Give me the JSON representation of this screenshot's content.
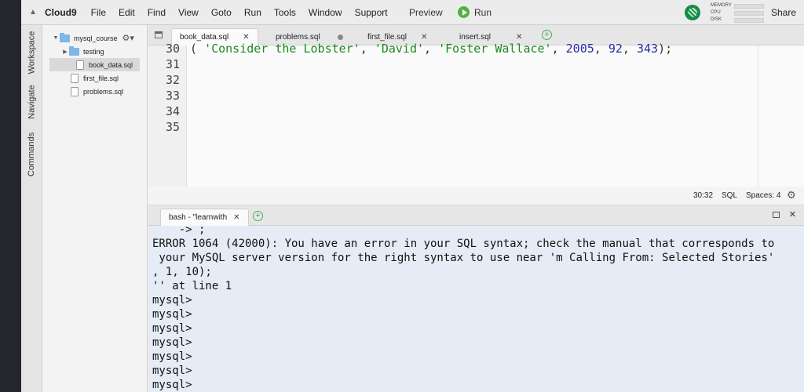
{
  "menubar": {
    "brand": "Cloud9",
    "items": [
      "File",
      "Edit",
      "Find",
      "View",
      "Goto",
      "Run",
      "Tools",
      "Window",
      "Support"
    ],
    "preview": "Preview",
    "run": "Run",
    "meters": [
      "MEMORY",
      "CPU",
      "DISK"
    ],
    "share": "Share"
  },
  "sidetabs": [
    "Workspace",
    "Navigate",
    "Commands"
  ],
  "tree": {
    "root": "mysql_course",
    "items": [
      {
        "label": "testing",
        "type": "folder"
      },
      {
        "label": "book_data.sql",
        "type": "file",
        "selected": true
      },
      {
        "label": "first_file.sql",
        "type": "file"
      },
      {
        "label": "problems.sql",
        "type": "file"
      }
    ]
  },
  "editor_tabs": [
    {
      "label": "book_data.sql",
      "state": "close",
      "active": true
    },
    {
      "label": "problems.sql",
      "state": "unsaved"
    },
    {
      "label": "first_file.sql",
      "state": "close"
    },
    {
      "label": "insert.sql",
      "state": "close"
    }
  ],
  "editor": {
    "line_numbers": [
      "30",
      "31",
      "32",
      "33",
      "34",
      "35"
    ],
    "line30": {
      "open": "(",
      "s1": "'Consider the Lobster'",
      "s2": "'David'",
      "s3": "'Foster Wallace'",
      "n1": "2005",
      "n2": "92",
      "n3": "343",
      "close": ");"
    }
  },
  "status": {
    "position": "30:32",
    "mode": "SQL",
    "spaces": "Spaces: 4"
  },
  "terminal_tab": "bash - \"learnwith",
  "terminal_lines": [
    "    -> ;",
    "ERROR 1064 (42000): You have an error in your SQL syntax; check the manual that corresponds to",
    " your MySQL server version for the right syntax to use near 'm Calling From: Selected Stories'",
    ", 1, 10);",
    "'' at line 1",
    "mysql>",
    "mysql>",
    "mysql>",
    "mysql>",
    "mysql>",
    "mysql>",
    "mysql>"
  ]
}
